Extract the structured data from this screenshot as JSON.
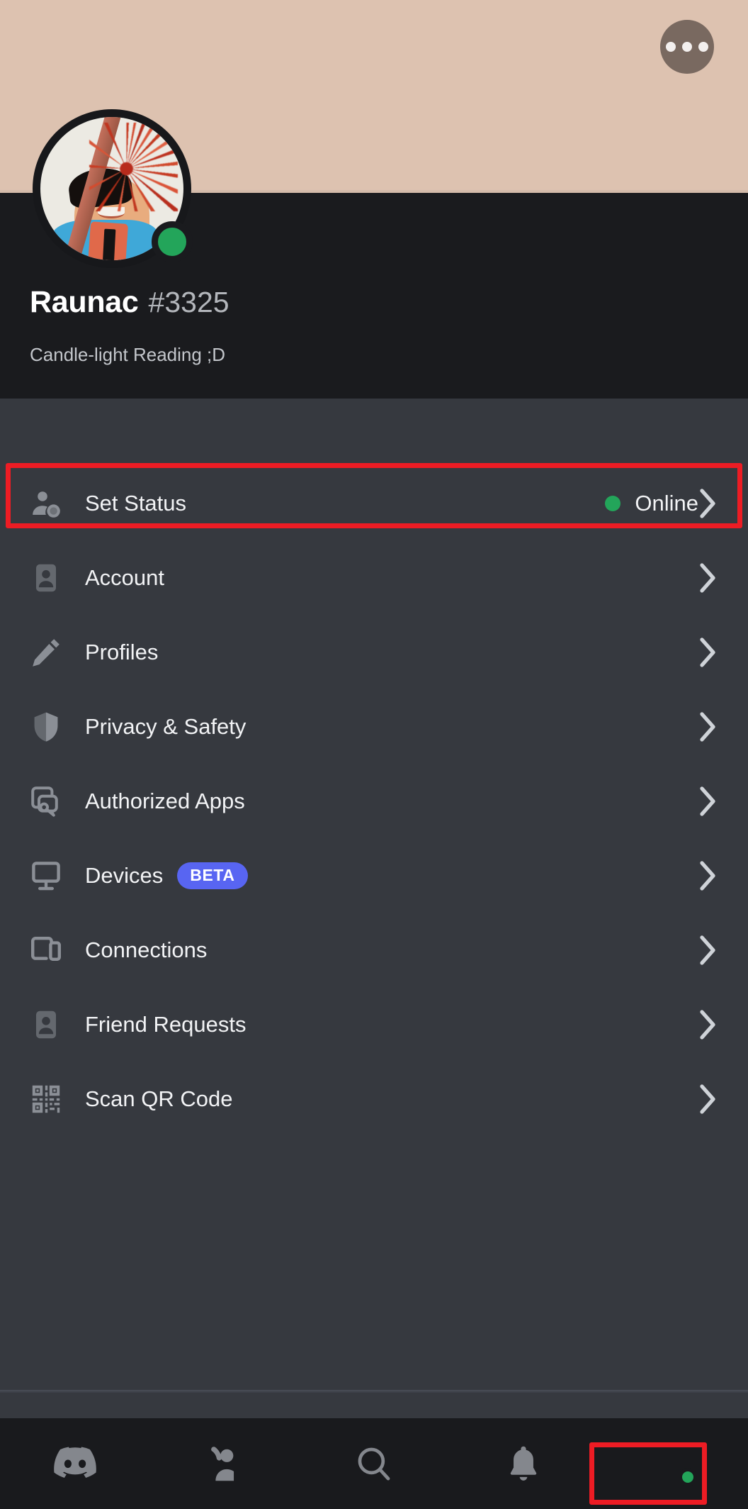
{
  "banner": {
    "color": "#ddc2b0",
    "overflow_button": "more-options"
  },
  "profile": {
    "username": "Raunac",
    "discriminator": "#3325",
    "custom_status": "Candle-light Reading ;D",
    "presence": "online",
    "presence_color": "#23a55a"
  },
  "settings": {
    "rows": [
      {
        "label": "Set Status",
        "icon": "person-status-icon",
        "value": "Online",
        "has_status_dot": true,
        "status_color": "#23a55a",
        "badge": null,
        "highlighted": true
      },
      {
        "label": "Account",
        "icon": "id-card-icon",
        "value": null,
        "has_status_dot": false,
        "badge": null,
        "highlighted": false
      },
      {
        "label": "Profiles",
        "icon": "pencil-icon",
        "value": null,
        "has_status_dot": false,
        "badge": null,
        "highlighted": false
      },
      {
        "label": "Privacy & Safety",
        "icon": "shield-icon",
        "value": null,
        "has_status_dot": false,
        "badge": null,
        "highlighted": false
      },
      {
        "label": "Authorized Apps",
        "icon": "app-key-icon",
        "value": null,
        "has_status_dot": false,
        "badge": null,
        "highlighted": false
      },
      {
        "label": "Devices",
        "icon": "monitor-icon",
        "value": null,
        "has_status_dot": false,
        "badge": "BETA",
        "badge_color": "#5865f2",
        "highlighted": false
      },
      {
        "label": "Connections",
        "icon": "devices-icon",
        "value": null,
        "has_status_dot": false,
        "badge": null,
        "highlighted": false
      },
      {
        "label": "Friend Requests",
        "icon": "id-card-icon",
        "value": null,
        "has_status_dot": false,
        "badge": null,
        "highlighted": false
      },
      {
        "label": "Scan QR Code",
        "icon": "qr-code-icon",
        "value": null,
        "has_status_dot": false,
        "badge": null,
        "highlighted": false
      }
    ]
  },
  "bottom_nav": {
    "items": [
      {
        "icon": "discord-logo-icon",
        "name": "servers-tab",
        "selected": false
      },
      {
        "icon": "friends-icon",
        "name": "friends-tab",
        "selected": false
      },
      {
        "icon": "search-icon",
        "name": "search-tab",
        "selected": false
      },
      {
        "icon": "bell-icon",
        "name": "notifications-tab",
        "selected": false
      },
      {
        "icon": "user-avatar-icon",
        "name": "profile-tab",
        "selected": true
      }
    ]
  },
  "annotations": {
    "highlight_color": "#ed1c24",
    "boxes": [
      "set-status-row",
      "profile-tab"
    ]
  }
}
